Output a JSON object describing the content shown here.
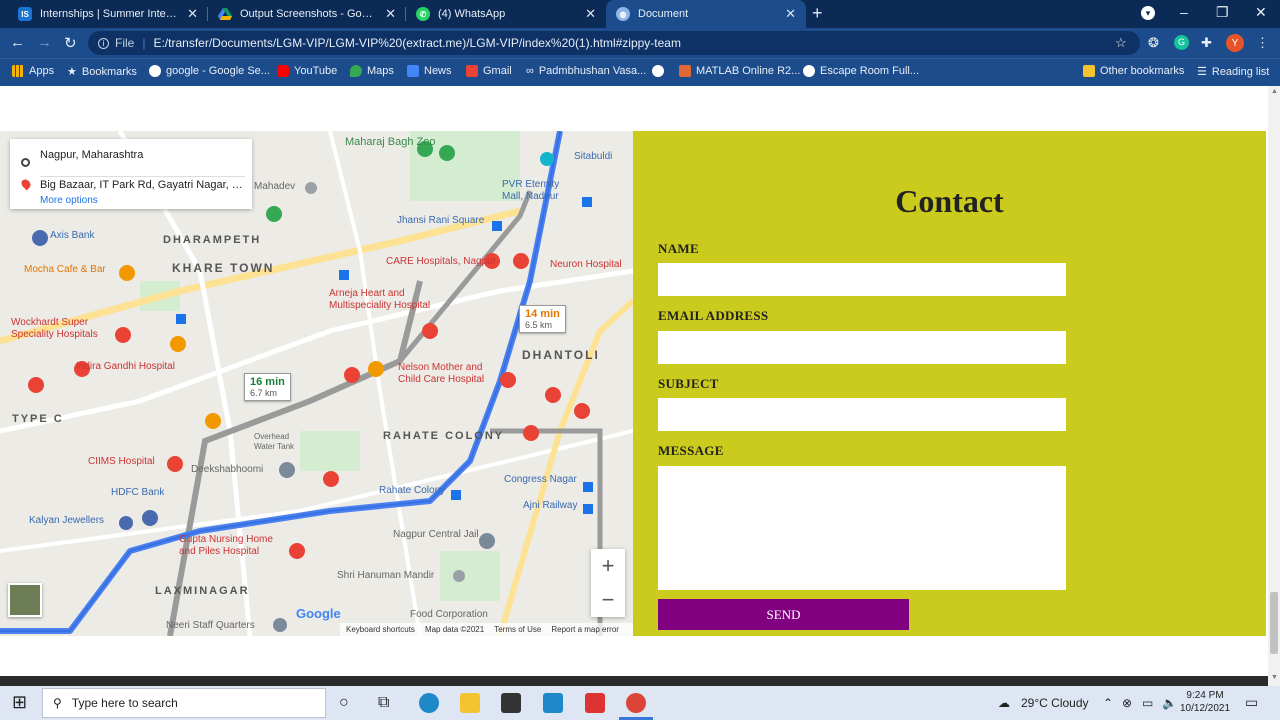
{
  "browser": {
    "tabs": [
      {
        "title": "Internships | Summer Internship",
        "favicon": "is-icon",
        "color": "#1a75d2"
      },
      {
        "title": "Output Screenshots - Google Dri",
        "favicon": "drive-icon",
        "color": "#f4b400"
      },
      {
        "title": "(4) WhatsApp",
        "favicon": "whatsapp-icon",
        "color": "#25d366"
      },
      {
        "title": "Document",
        "favicon": "globe-icon",
        "color": "#8fb4e8",
        "active": true
      }
    ],
    "url_scheme": "File",
    "url": "E:/transfer/Documents/LGM-VIP/LGM-VIP%20(extract.me)/LGM-VIP/index%20(1).html#zippy-team",
    "profile_initial": "Y"
  },
  "bookmarks": {
    "items": [
      "Apps",
      "Bookmarks",
      "google - Google Se...",
      "YouTube",
      "Maps",
      "News",
      "Gmail",
      "Padmbhushan Vasa...",
      "",
      "MATLAB Online R2...",
      "Escape Room Full..."
    ],
    "right": [
      "Other bookmarks",
      "Reading list"
    ]
  },
  "map": {
    "origin": "Nagpur, Maharashtra",
    "destination": "Big Bazaar, IT Park Rd, Gayatri Nagar, Pr...",
    "more_options": "More options",
    "routes": [
      {
        "time": "14 min",
        "distance": "6.5 km",
        "selected": true
      },
      {
        "time": "16 min",
        "distance": "6.7 km"
      }
    ],
    "labels": {
      "maharaj_bagh": "Maharaj Bagh Zoo",
      "pvr": "PVR Eternity Mall, Nadpur",
      "sitabuldi": "Sitabuldi",
      "mahadev": "Mahadev",
      "jhansi": "Jhansi Rani Square",
      "axis": "Axis Bank",
      "dharampeth": "DHARAMPETH",
      "mocha": "Mocha Cafe & Bar",
      "khare": "KHARE TOWN",
      "care": "CARE Hospitals, Nagpur",
      "neuron": "Neuron Hospital",
      "arneja": "Arneja Heart and Multispeciality Hospital",
      "wockhardt": "Wockhardt Super Speciality Hospitals",
      "dhantoli": "DHANTOLI",
      "indira": "Indira Gandhi Hospital",
      "nelson": "Nelson Mother and Child Care Hospital",
      "rahate": "RAHATE COLONY",
      "ciims": "CIIMS Hospital",
      "deeksha": "Deekshabhoomi",
      "overhead": "Overhead Water Tank",
      "hdfc": "HDFC Bank",
      "congress": "Congress Nagar",
      "ajni": "Ajni Railway",
      "kalyan": "Kalyan Jewellers",
      "gupta": "Gupta Nursing Home and Piles Hospital",
      "jail": "Nagpur Central Jail",
      "hanuman": "Shri Hanuman Mandir",
      "laxminagar": "LAXMINAGAR",
      "neeri": "Neeri Staff Quarters",
      "food": "Food Corporation",
      "typec": "TYPE C",
      "rahate_stn": "Rahate Colony"
    },
    "zoom_in": "+",
    "zoom_out": "−",
    "google": "Google",
    "attribution": [
      "Keyboard shortcuts",
      "Map data ©2021",
      "Terms of Use",
      "Report a map error"
    ]
  },
  "contact": {
    "heading": "Contact",
    "fields": [
      {
        "label": "NAME",
        "value": ""
      },
      {
        "label": "EMAIL ADDRESS",
        "value": ""
      },
      {
        "label": "SUBJECT",
        "value": ""
      },
      {
        "label": "MESSAGE",
        "value": ""
      }
    ],
    "send_label": "SEND",
    "background": "#cbcb1d",
    "button_color": "#800080"
  },
  "taskbar": {
    "search_placeholder": "Type here to search",
    "weather": "29°C  Cloudy",
    "time": "9:24 PM",
    "date": "10/12/2021"
  }
}
